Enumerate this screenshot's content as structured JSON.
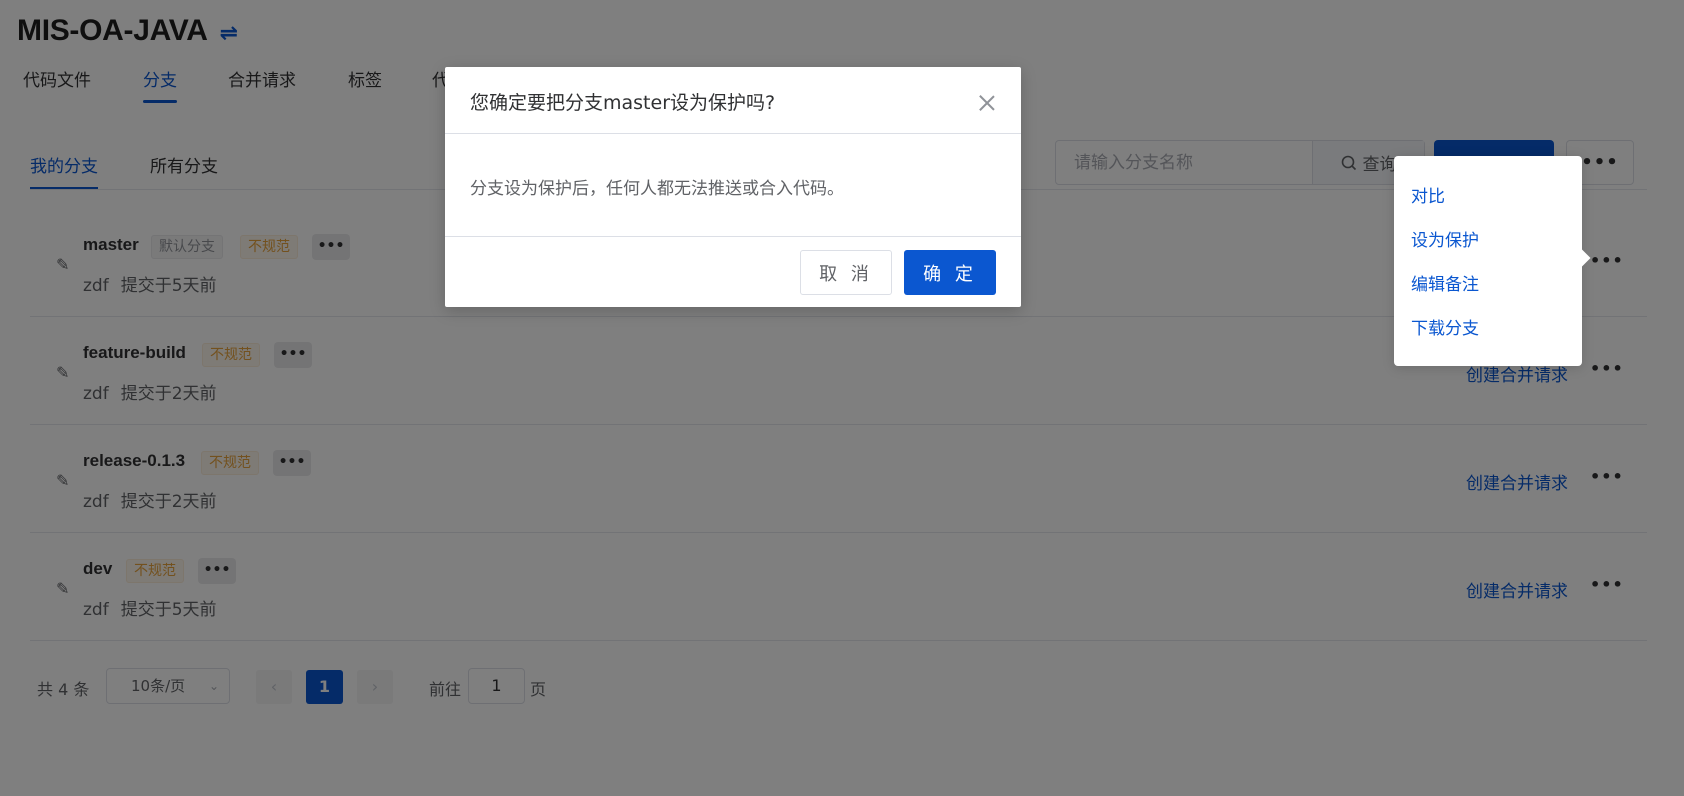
{
  "project": {
    "title": "MIS-OA-JAVA",
    "switch_icon": "⇌"
  },
  "top_tabs": [
    {
      "label": "代码文件"
    },
    {
      "label": "分支"
    },
    {
      "label": "合并请求"
    },
    {
      "label": "标签"
    },
    {
      "label": "代"
    }
  ],
  "sub_tabs": [
    {
      "label": "我的分支"
    },
    {
      "label": "所有分支"
    }
  ],
  "toolbar": {
    "search_placeholder": "请输入分支名称",
    "search_button": "查询",
    "more": "•••"
  },
  "branches": [
    {
      "name": "master",
      "default_tag": "默认分支",
      "warn_tag": "不规范",
      "more": "•••",
      "author": "zdf",
      "commit_time": "提交于5天前",
      "create_mr": "",
      "row_more": "•••"
    },
    {
      "name": "feature-build",
      "default_tag": "",
      "warn_tag": "不规范",
      "more": "•••",
      "author": "zdf",
      "commit_time": "提交于2天前",
      "create_mr": "创建合并请求",
      "row_more": "•••"
    },
    {
      "name": "release-0.1.3",
      "default_tag": "",
      "warn_tag": "不规范",
      "more": "•••",
      "author": "zdf",
      "commit_time": "提交于2天前",
      "create_mr": "创建合并请求",
      "row_more": "•••"
    },
    {
      "name": "dev",
      "default_tag": "",
      "warn_tag": "不规范",
      "more": "•••",
      "author": "zdf",
      "commit_time": "提交于5天前",
      "create_mr": "创建合并请求",
      "row_more": "•••"
    }
  ],
  "pagination": {
    "total": "共 4 条",
    "page_size": "10条/页",
    "current_page": "1",
    "goto_label": "前往",
    "goto_value": "1",
    "page_suffix": "页"
  },
  "dropdown": {
    "items": [
      {
        "label": "对比"
      },
      {
        "label": "设为保护"
      },
      {
        "label": "编辑备注"
      },
      {
        "label": "下载分支"
      }
    ]
  },
  "dialog": {
    "title": "您确定要把分支master设为保护吗?",
    "body": "分支设为保护后，任何人都无法推送或合入代码。",
    "cancel": "取 消",
    "confirm": "确 定"
  },
  "colors": {
    "accent": "#0b57d0",
    "warning": "#e6a23c",
    "overlay": "rgba(0,0,0,0.5)"
  }
}
